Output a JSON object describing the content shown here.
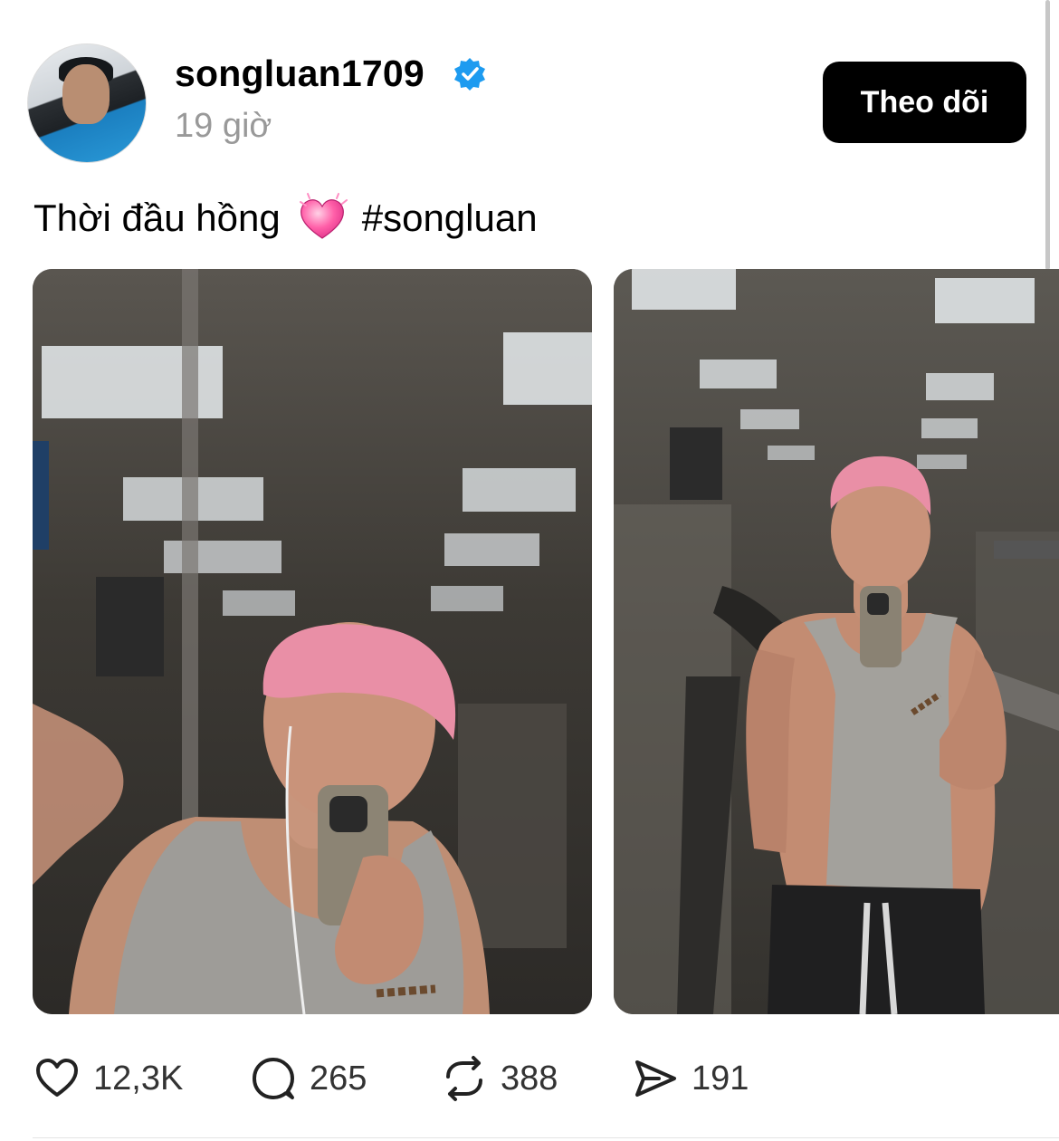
{
  "post": {
    "username": "songluan1709",
    "time": "19 giờ",
    "follow_label": "Theo dõi",
    "caption_text": "Thời đầu hồng",
    "caption_emoji": "heart-emoji",
    "hashtag": "#songluan"
  },
  "photos": [
    {
      "description_icon": "mirror-selfie-photo"
    },
    {
      "description_icon": "gym-selfie-photo"
    }
  ],
  "actions": {
    "likes": "12,3K",
    "comments": "265",
    "reposts": "388",
    "shares": "191"
  },
  "colors": {
    "verified": "#1d9bf0",
    "hair_pink": "#e98fa6",
    "button_bg": "#000000",
    "muted_text": "#999999"
  }
}
